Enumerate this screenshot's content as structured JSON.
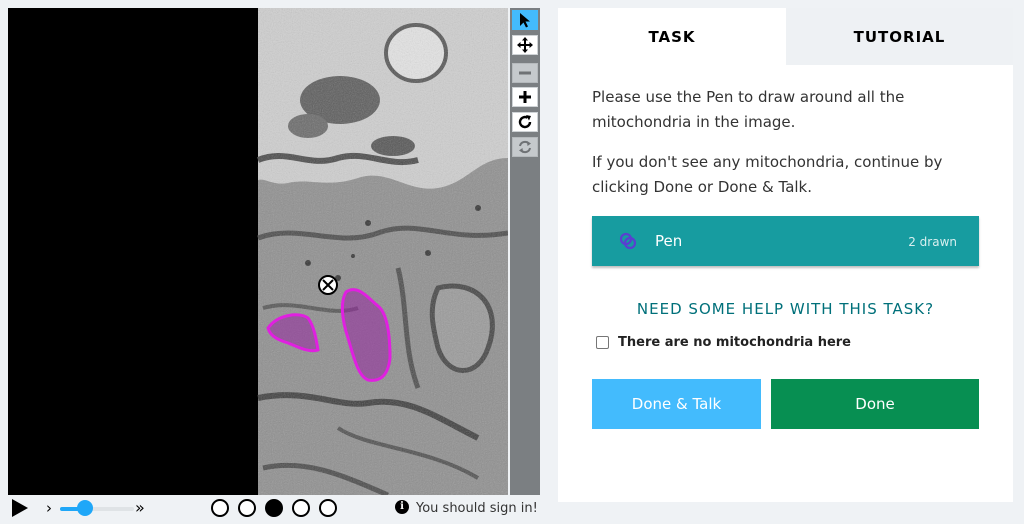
{
  "tabs": [
    {
      "label": "TASK"
    },
    {
      "label": "TUTORIAL"
    }
  ],
  "task": {
    "instruction_1": "Please use the Pen to draw around all the mitochondria in the image.",
    "instruction_2": "If you don't see any mitochondria, continue by clicking Done or Done & Talk.",
    "pen_tool": {
      "label": "Pen",
      "count": "2 drawn",
      "icon": "pen-icon"
    },
    "help_link": "NEED SOME HELP WITH THIS TASK?",
    "no_mitochondria_label": "There are no mitochondria here",
    "done_talk_label": "Done & Talk",
    "done_label": "Done"
  },
  "viewer_tools": [
    {
      "icon": "pointer-icon",
      "active": true
    },
    {
      "icon": "move-icon",
      "active": false
    },
    {
      "icon": "zoom-out-icon",
      "active": false,
      "disabled": true
    },
    {
      "icon": "zoom-in-icon",
      "active": false
    },
    {
      "icon": "rotate-icon",
      "active": false
    },
    {
      "icon": "reset-icon",
      "active": false,
      "disabled": true
    }
  ],
  "player": {
    "frame_count": 5,
    "current_frame": 3,
    "speed_level": 0.25,
    "signin_text": "You should sign in!"
  },
  "colors": {
    "accent_teal": "#179ca0",
    "done_green": "#078f52",
    "talk_blue": "#43bbfd",
    "annotation_magenta": "#e020e0"
  }
}
